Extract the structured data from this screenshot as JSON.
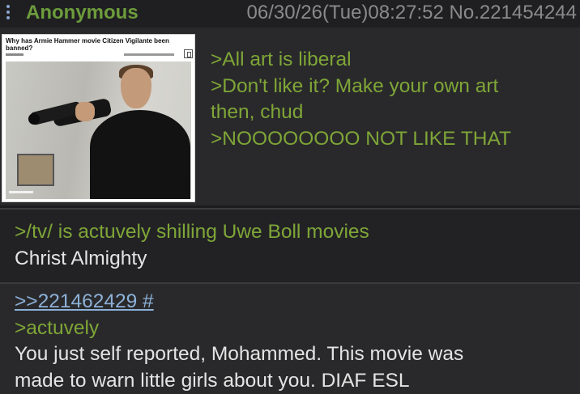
{
  "header": {
    "name": "Anonymous",
    "datetime": "06/30/26(Tue)08:27:52",
    "post_no": "No.221454244"
  },
  "post1": {
    "thumbnail_headline": "Why has Armie Hammer movie Citizen Vigilante been banned?",
    "lines": [
      ">All art is liberal",
      ">Don't like it? Make your own art",
      "then, chud",
      ">NOOOOOOOO NOT LIKE THAT"
    ]
  },
  "post2": {
    "greentext": ">/tv/ is actuvely shilling Uwe Boll movies",
    "text": "Christ Almighty"
  },
  "post3": {
    "quotelink": ">>221462429 #",
    "greentext": ">actuvely",
    "lines": [
      "You just self reported, Mohammed. This movie was",
      "made to warn little girls about you. DIAF ESL"
    ]
  },
  "colors": {
    "background": "#1c1c1f",
    "greentext": "#7fa637",
    "name": "#6d9c3c",
    "quotelink": "#8db1d8",
    "text": "#e4e4e4",
    "meta": "#8a8a8a"
  },
  "icons": [
    "menu-icon"
  ]
}
